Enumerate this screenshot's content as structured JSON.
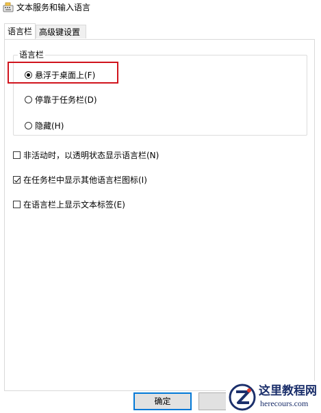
{
  "window": {
    "title": "文本服务和输入语言"
  },
  "tabs": [
    {
      "label": "语言栏",
      "active": true
    },
    {
      "label": "高级键设置",
      "active": false
    }
  ],
  "language_bar_group": {
    "legend": "语言栏",
    "options": [
      {
        "label": "悬浮于桌面上(F)",
        "checked": true
      },
      {
        "label": "停靠于任务栏(D)",
        "checked": false
      },
      {
        "label": "隐藏(H)",
        "checked": false
      }
    ]
  },
  "checkboxes": [
    {
      "label": "非活动时，以透明状态显示语言栏(N)",
      "checked": false
    },
    {
      "label": "在任务栏中显示其他语言栏图标(I)",
      "checked": true
    },
    {
      "label": "在语言栏上显示文本标签(E)",
      "checked": false
    }
  ],
  "buttons": {
    "ok_label": "确定"
  },
  "watermark": {
    "cn_text": "这里教程网",
    "en_text": "herecours.com"
  },
  "colors": {
    "highlight_border": "#d0121b",
    "ok_button_border": "#0078d7",
    "watermark_text": "#1b2f6b"
  }
}
